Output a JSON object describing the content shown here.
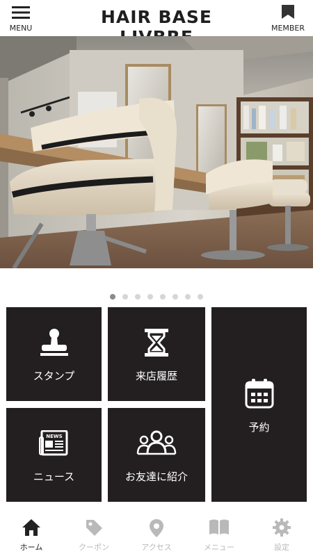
{
  "header": {
    "menu_label": "MENU",
    "title": "HAIR BASE LIVBRE",
    "member_label": "MEMBER"
  },
  "carousel": {
    "slide_count": 8,
    "active_index": 0
  },
  "tiles": {
    "stamp": "スタンプ",
    "visit_history": "来店履歴",
    "reservation": "予約",
    "news": "ニュース",
    "refer_friend": "お友達に紹介"
  },
  "tabs": [
    {
      "label": "ホーム",
      "icon": "home-icon",
      "active": true
    },
    {
      "label": "クーポン",
      "icon": "coupon-tag-icon",
      "active": false
    },
    {
      "label": "アクセス",
      "icon": "map-pin-icon",
      "active": false
    },
    {
      "label": "メニュー",
      "icon": "book-icon",
      "active": false
    },
    {
      "label": "設定",
      "icon": "gear-icon",
      "active": false
    }
  ],
  "colors": {
    "tile_bg": "#231f20",
    "tab_active": "#222222",
    "tab_inactive": "#b9b9b9",
    "dot_active": "#8a8a8a",
    "dot_inactive": "#d6d6d6"
  }
}
